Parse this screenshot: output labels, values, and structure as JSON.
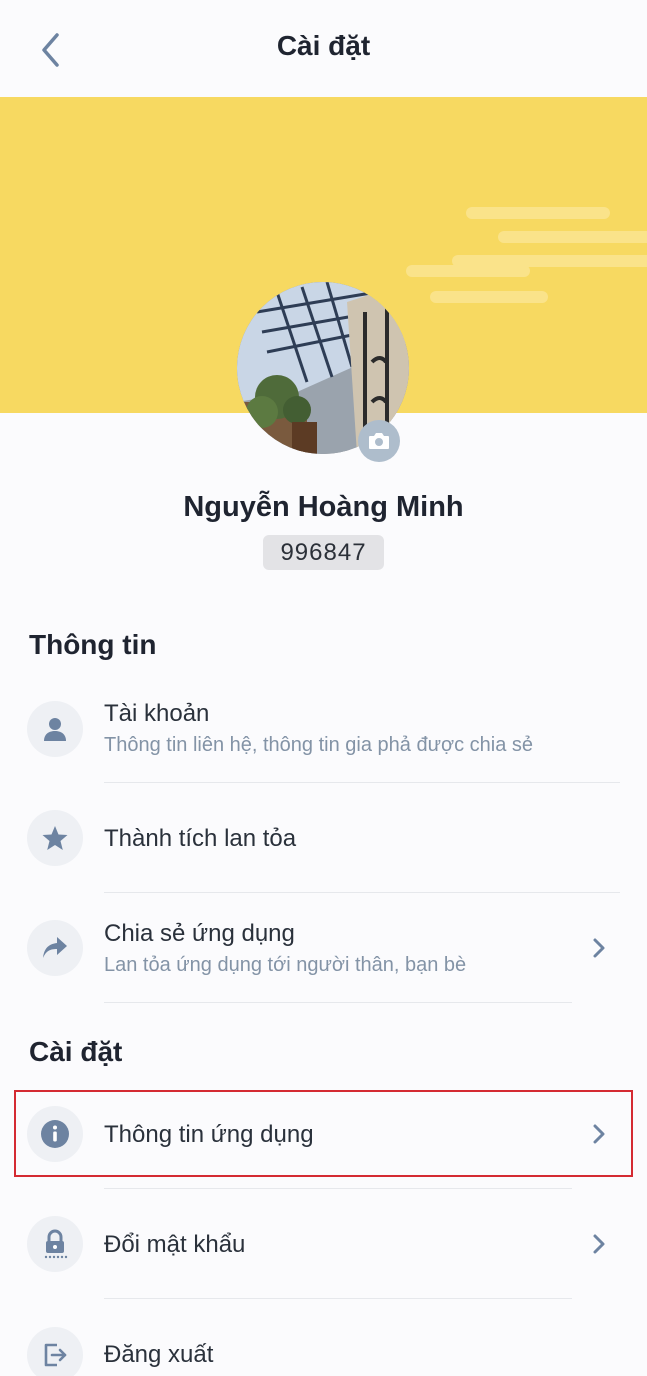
{
  "header": {
    "title": "Cài đặt",
    "back_icon": "chevron-left-icon"
  },
  "profile": {
    "name": "Nguyễn Hoàng Minh",
    "id": "996847",
    "banner_color": "#f7d961",
    "camera_icon": "camera-icon"
  },
  "sections": {
    "info_title": "Thông tin",
    "settings_title": "Cài đặt"
  },
  "items": {
    "account": {
      "title": "Tài khoản",
      "subtitle": "Thông tin liên hệ, thông tin gia phả được chia sẻ",
      "icon": "user-icon"
    },
    "achievements": {
      "title": "Thành tích lan tỏa",
      "icon": "star-icon"
    },
    "share": {
      "title": "Chia sẻ ứng dụng",
      "subtitle": "Lan tỏa ứng dụng tới người thân, bạn bè",
      "icon": "share-arrow-icon"
    },
    "app_info": {
      "title": "Thông tin ứng dụng",
      "icon": "info-icon"
    },
    "change_password": {
      "title": "Đổi mật khẩu",
      "icon": "lock-icon"
    },
    "logout": {
      "title": "Đăng xuất",
      "icon": "logout-icon"
    }
  },
  "colors": {
    "accent": "#6d83a1",
    "highlight": "#d42a32"
  }
}
